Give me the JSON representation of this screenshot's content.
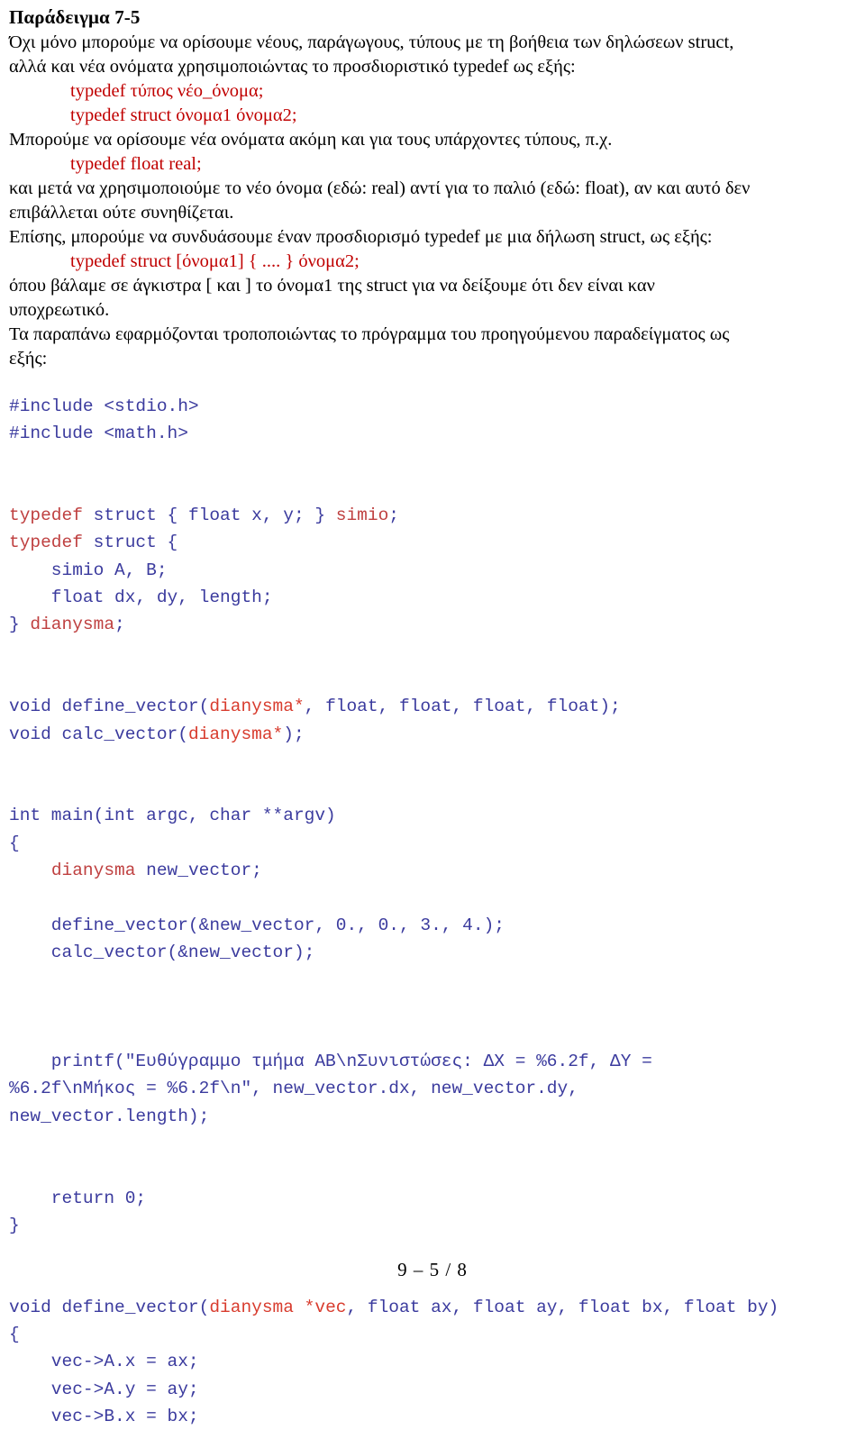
{
  "document": {
    "title": "Παράδειγμα 7-5",
    "page_footer": "9 – 5 / 8",
    "colors": {
      "prose_text": "#000000",
      "inline_code_red": "#c00000",
      "code_blue": "#3b3b9e",
      "code_red": "#bf4040",
      "code_red_bright": "#d83c2e",
      "page_background": "#ffffff"
    }
  },
  "prose": {
    "p1_line1": "Όχι μόνο μπορούμε να ορίσουμε νέους, παράγωγους, τύπους με τη βοήθεια των δηλώσεων struct,",
    "p1_line2": "αλλά και νέα ονόματα χρησιμοποιώντας το προσδιοριστικό typedef ως εξής:",
    "snippet1_line1": "typedef τύπος νέο_όνομα;",
    "snippet1_line2": "typedef struct όνομα1 όνομα2;",
    "p2": "Μπορούμε να ορίσουμε νέα ονόματα ακόμη και για τους υπάρχοντες τύπους, π.χ.",
    "snippet2": "typedef float real;",
    "p3_line1": "και μετά να χρησιμοποιούμε το νέο όνομα (εδώ: real) αντί για το παλιό (εδώ: float), αν και αυτό δεν",
    "p3_line2": "επιβάλλεται ούτε συνηθίζεται.",
    "p4": "Επίσης, μπορούμε να συνδυάσουμε έναν προσδιορισμό typedef με μια δήλωση struct, ως εξής:",
    "snippet3": "typedef struct [όνομα1] { .... } όνομα2;",
    "p5_line1": "όπου βάλαμε σε άγκιστρα [ και ] το όνομα1 της struct για να δείξουμε ότι δεν είναι καν",
    "p5_line2": "υποχρεωτικό.",
    "p6_line1": "Τα παραπάνω εφαρμόζονται τροποποιώντας το πρόγραμμα του προηγούμενου παραδείγματος ως",
    "p6_line2": "εξής:"
  },
  "code_listing": {
    "language": "C",
    "lines": [
      {
        "id": "l01",
        "segments": [
          {
            "t": "#include <stdio.h>",
            "c": "blue"
          }
        ]
      },
      {
        "id": "l02",
        "segments": [
          {
            "t": "#include <math.h>",
            "c": "blue"
          }
        ]
      },
      {
        "id": "l03",
        "segments": []
      },
      {
        "id": "l04",
        "segments": []
      },
      {
        "id": "l05",
        "segments": [
          {
            "t": "typedef",
            "c": "red"
          },
          {
            "t": " struct { float x, y; } ",
            "c": "blue"
          },
          {
            "t": "simio",
            "c": "red"
          },
          {
            "t": ";",
            "c": "blue"
          }
        ]
      },
      {
        "id": "l06",
        "segments": [
          {
            "t": "typedef",
            "c": "red"
          },
          {
            "t": " struct {",
            "c": "blue"
          }
        ]
      },
      {
        "id": "l07",
        "segments": [
          {
            "t": "    simio A, B;",
            "c": "blue"
          }
        ]
      },
      {
        "id": "l08",
        "segments": [
          {
            "t": "    float dx, dy, length;",
            "c": "blue"
          }
        ]
      },
      {
        "id": "l09",
        "segments": [
          {
            "t": "} ",
            "c": "blue"
          },
          {
            "t": "dianysma",
            "c": "red"
          },
          {
            "t": ";",
            "c": "blue"
          }
        ]
      },
      {
        "id": "l10",
        "segments": []
      },
      {
        "id": "l11",
        "segments": []
      },
      {
        "id": "l12",
        "segments": [
          {
            "t": "void define_vector(",
            "c": "blue"
          },
          {
            "t": "dianysma*",
            "c": "red2"
          },
          {
            "t": ", float, float, float, float);",
            "c": "blue"
          }
        ]
      },
      {
        "id": "l13",
        "segments": [
          {
            "t": "void calc_vector(",
            "c": "blue"
          },
          {
            "t": "dianysma*",
            "c": "red2"
          },
          {
            "t": ");",
            "c": "blue"
          }
        ]
      },
      {
        "id": "l14",
        "segments": []
      },
      {
        "id": "l15",
        "segments": []
      },
      {
        "id": "l16",
        "segments": [
          {
            "t": "int main(int argc, char **argv)",
            "c": "blue"
          }
        ]
      },
      {
        "id": "l17",
        "segments": [
          {
            "t": "{",
            "c": "blue"
          }
        ]
      },
      {
        "id": "l18",
        "segments": [
          {
            "t": "    ",
            "c": "blue"
          },
          {
            "t": "dianysma",
            "c": "red"
          },
          {
            "t": " new_vector;",
            "c": "blue"
          }
        ]
      },
      {
        "id": "l19",
        "segments": []
      },
      {
        "id": "l20",
        "segments": [
          {
            "t": "    define_vector(&new_vector, 0., 0., 3., 4.);",
            "c": "blue"
          }
        ]
      },
      {
        "id": "l21",
        "segments": [
          {
            "t": "    calc_vector(&new_vector);",
            "c": "blue"
          }
        ]
      },
      {
        "id": "l22",
        "segments": []
      },
      {
        "id": "l23",
        "segments": []
      },
      {
        "id": "l24",
        "segments": []
      },
      {
        "id": "l25",
        "segments": [
          {
            "t": "    printf(\"Ευθύγραμμο τμήμα ΑΒ\\nΣυνιστώσες: ΔΧ = %6.2f, ΔΥ =",
            "c": "blue"
          }
        ]
      },
      {
        "id": "l26",
        "segments": [
          {
            "t": "%6.2f\\nΜήκος = %6.2f\\n\", new_vector.dx, new_vector.dy,",
            "c": "blue"
          }
        ]
      },
      {
        "id": "l27",
        "segments": [
          {
            "t": "new_vector.length);",
            "c": "blue"
          }
        ]
      },
      {
        "id": "l28",
        "segments": []
      },
      {
        "id": "l29",
        "segments": []
      },
      {
        "id": "l30",
        "segments": [
          {
            "t": "    return 0;",
            "c": "blue"
          }
        ]
      },
      {
        "id": "l31",
        "segments": [
          {
            "t": "}",
            "c": "blue"
          }
        ]
      },
      {
        "id": "l32",
        "segments": []
      },
      {
        "id": "l33",
        "segments": []
      },
      {
        "id": "l34",
        "segments": [
          {
            "t": "void define_vector(",
            "c": "blue"
          },
          {
            "t": "dianysma *vec",
            "c": "red2"
          },
          {
            "t": ", float ax, float ay, float bx, float by)",
            "c": "blue"
          }
        ]
      },
      {
        "id": "l35",
        "segments": [
          {
            "t": "{",
            "c": "blue"
          }
        ]
      },
      {
        "id": "l36",
        "segments": [
          {
            "t": "    vec->A.x = ax;",
            "c": "blue"
          }
        ]
      },
      {
        "id": "l37",
        "segments": [
          {
            "t": "    vec->A.y = ay;",
            "c": "blue"
          }
        ]
      },
      {
        "id": "l38",
        "segments": [
          {
            "t": "    vec->B.x = bx;",
            "c": "blue"
          }
        ]
      }
    ]
  }
}
